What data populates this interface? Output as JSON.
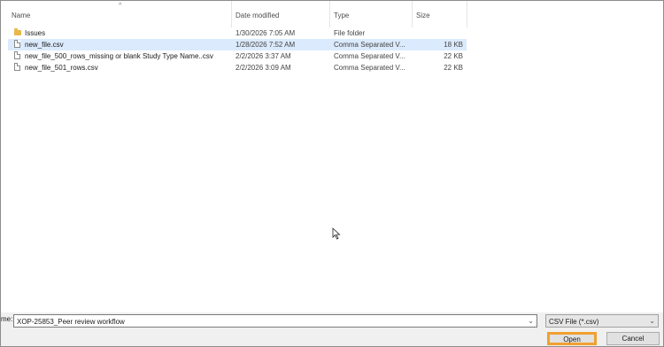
{
  "columns": {
    "name": "Name",
    "date_modified": "Date modified",
    "type": "Type",
    "size": "Size"
  },
  "files": [
    {
      "name": "Issues",
      "date": "1/30/2026 7:05 AM",
      "type": "File folder",
      "size": "",
      "icon": "folder-icon",
      "selected": false
    },
    {
      "name": "new_file.csv",
      "date": "1/28/2026 7:52 AM",
      "type": "Comma Separated V...",
      "size": "18 KB",
      "icon": "csv-file-icon",
      "selected": true
    },
    {
      "name": "new_file_500_rows_missing or blank Study Type Name..csv",
      "date": "2/2/2026 3:37 AM",
      "type": "Comma Separated V...",
      "size": "22 KB",
      "icon": "csv-file-icon",
      "selected": false
    },
    {
      "name": "new_file_501_rows.csv",
      "date": "2/2/2026 3:09 AM",
      "type": "Comma Separated V...",
      "size": "22 KB",
      "icon": "csv-file-icon",
      "selected": false
    }
  ],
  "footer": {
    "filename_label": "me:",
    "filename_value": "XOP-25853_Peer review workflow",
    "filetype_value": "CSV File (*.csv)",
    "open_label": "Open",
    "cancel_label": "Cancel"
  },
  "colors": {
    "selection": "#dbeafc",
    "open_highlight": "#f0a030",
    "folder": "#e8b84a"
  }
}
